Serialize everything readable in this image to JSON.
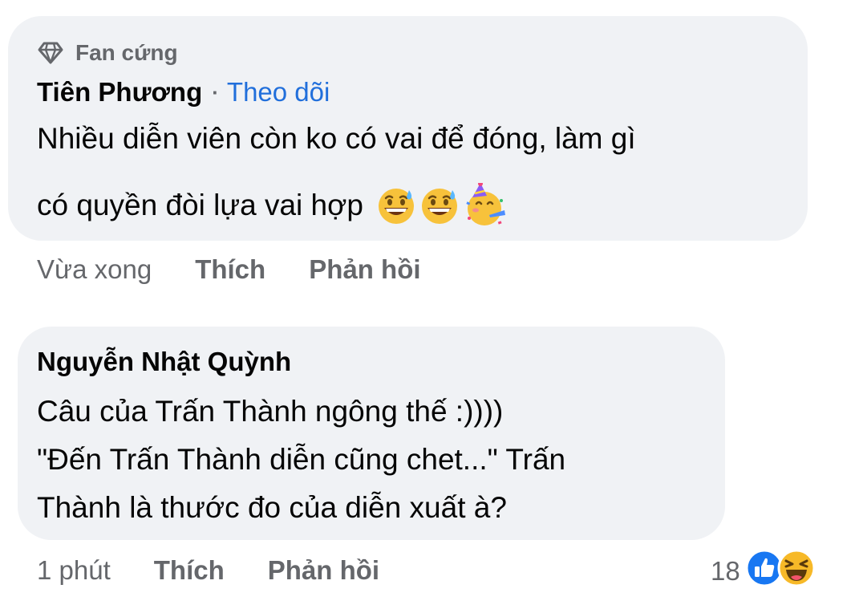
{
  "comment_1": {
    "badge": "Fan cứng",
    "badge_icon": "diamond-icon",
    "author": "Tiên Phương",
    "separator": "·",
    "follow_label": "Theo dõi",
    "text_line_1": "Nhiều diễn viên còn ko có vai để đóng, làm gì",
    "text_line_2": "có quyền đòi lựa vai hợp",
    "emojis": [
      "grinning-sweat-emoji",
      "grinning-sweat-emoji",
      "partying-face-emoji"
    ],
    "time": "Vừa xong",
    "like_label": "Thích",
    "reply_label": "Phản hồi"
  },
  "comment_2": {
    "author": "Nguyễn Nhật Quỳnh",
    "text_line_1": "Câu của Trấn Thành ngông thế :))))",
    "text_line_2": "\"Đến Trấn Thành diễn cũng chet...\" Trấn",
    "text_line_3": "Thành là thước đo của diễn xuất à?",
    "time": "1 phút",
    "like_label": "Thích",
    "reply_label": "Phản hồi",
    "reaction_count": "18",
    "reaction_icons": [
      "like-reaction-icon",
      "haha-reaction-icon"
    ]
  },
  "colors": {
    "bubble": "#f0f2f5",
    "secondary_text": "#65676b",
    "link": "#216fdb",
    "like_blue": "#1877f2",
    "haha_yellow": "#f7b928"
  }
}
